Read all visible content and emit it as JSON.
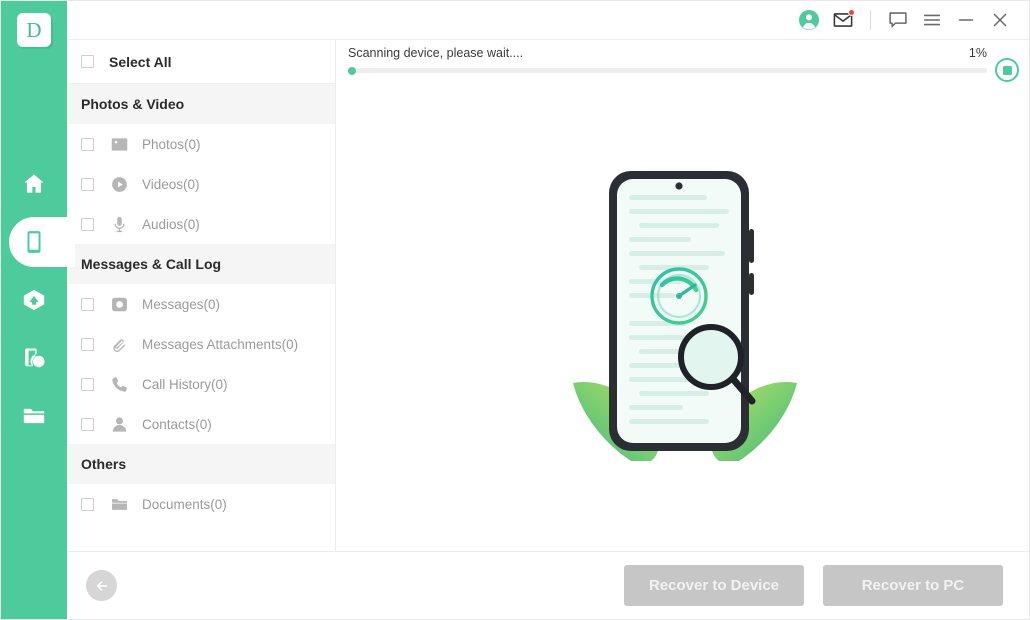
{
  "theme": {
    "accent": "#4ecb9c",
    "notification_dot": "#f0443a",
    "disabled_button": "#c6c6c6",
    "group_header_bg": "#f5f5f5",
    "row_text": "#9a9a9a"
  },
  "rail": {
    "logo_letter": "D",
    "items": [
      {
        "name": "home",
        "icon": "home-icon",
        "active": false
      },
      {
        "name": "device",
        "icon": "phone-icon",
        "active": true
      },
      {
        "name": "cloud",
        "icon": "cloud-icon",
        "active": false
      },
      {
        "name": "device-repair",
        "icon": "device-info-icon",
        "active": false
      },
      {
        "name": "files",
        "icon": "folder-icon",
        "active": false
      }
    ]
  },
  "titlebar": {
    "buttons": [
      {
        "name": "account",
        "icon": "account-avatar-icon"
      },
      {
        "name": "mail",
        "icon": "envelope-icon",
        "has_dot": true
      },
      {
        "name": "feedback",
        "icon": "chat-bubble-icon"
      },
      {
        "name": "menu",
        "icon": "hamburger-menu-icon"
      },
      {
        "name": "minimize",
        "icon": "minimize-icon"
      },
      {
        "name": "close",
        "icon": "close-icon"
      }
    ]
  },
  "filelist": {
    "select_all_label": "Select All",
    "groups": [
      {
        "title": "Photos & Video",
        "rows": [
          {
            "label": "Photos(0)",
            "icon": "photo-icon"
          },
          {
            "label": "Videos(0)",
            "icon": "video-play-icon"
          },
          {
            "label": "Audios(0)",
            "icon": "microphone-icon"
          }
        ]
      },
      {
        "title": "Messages & Call Log",
        "rows": [
          {
            "label": "Messages(0)",
            "icon": "message-icon"
          },
          {
            "label": "Messages Attachments(0)",
            "icon": "paperclip-icon"
          },
          {
            "label": "Call History(0)",
            "icon": "phone-call-icon"
          },
          {
            "label": "Contacts(0)",
            "icon": "contact-person-icon"
          }
        ]
      },
      {
        "title": "Others",
        "rows": [
          {
            "label": "Documents(0)",
            "icon": "folder-icon"
          }
        ]
      }
    ]
  },
  "scan": {
    "status_text": "Scanning device, please wait....",
    "percent_label": "1%",
    "percent_value": 1,
    "stop_button_name": "stop-scan-button"
  },
  "illustration": {
    "name": "phone-scanning-illustration",
    "elements": [
      "phone",
      "document-lines",
      "scan-gauge",
      "magnifying-glass",
      "leaves"
    ]
  },
  "footer": {
    "back_button_name": "back-button",
    "recover_to_device_label": "Recover to Device",
    "recover_to_pc_label": "Recover to PC"
  }
}
